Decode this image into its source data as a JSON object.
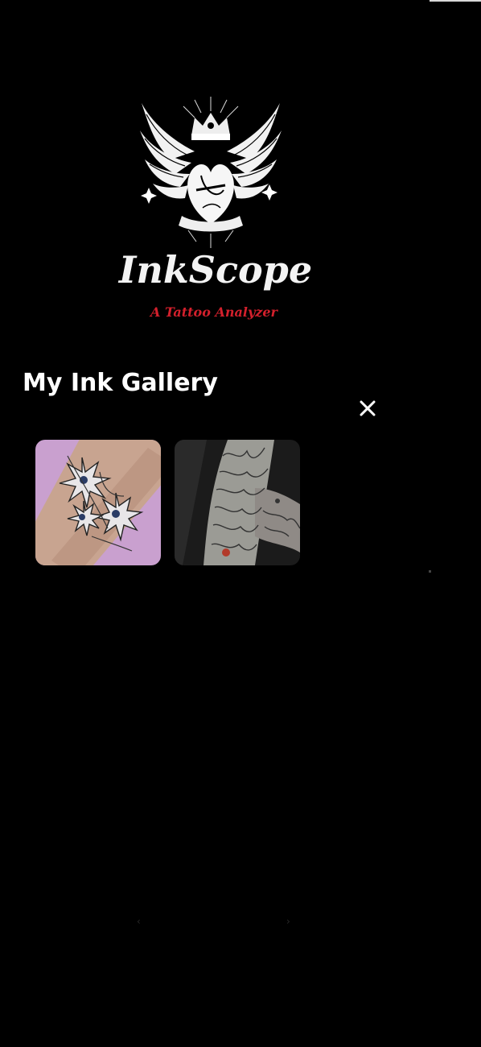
{
  "app": {
    "title": "InkScope",
    "subtitle": "A Tattoo Analyzer"
  },
  "gallery": {
    "title": "My Ink Gallery",
    "close_icon": "close-icon",
    "items": [
      {
        "icon": "tattoo-lily-flowers-photo"
      },
      {
        "icon": "tattoo-sleeve-arm-photo"
      }
    ]
  },
  "pager": {
    "prev_label": "‹",
    "next_label": "›"
  },
  "colors": {
    "background": "#000000",
    "accent_red": "#d3202c",
    "text": "#ffffff",
    "thumb_1_bg": "#c9a0cf"
  }
}
